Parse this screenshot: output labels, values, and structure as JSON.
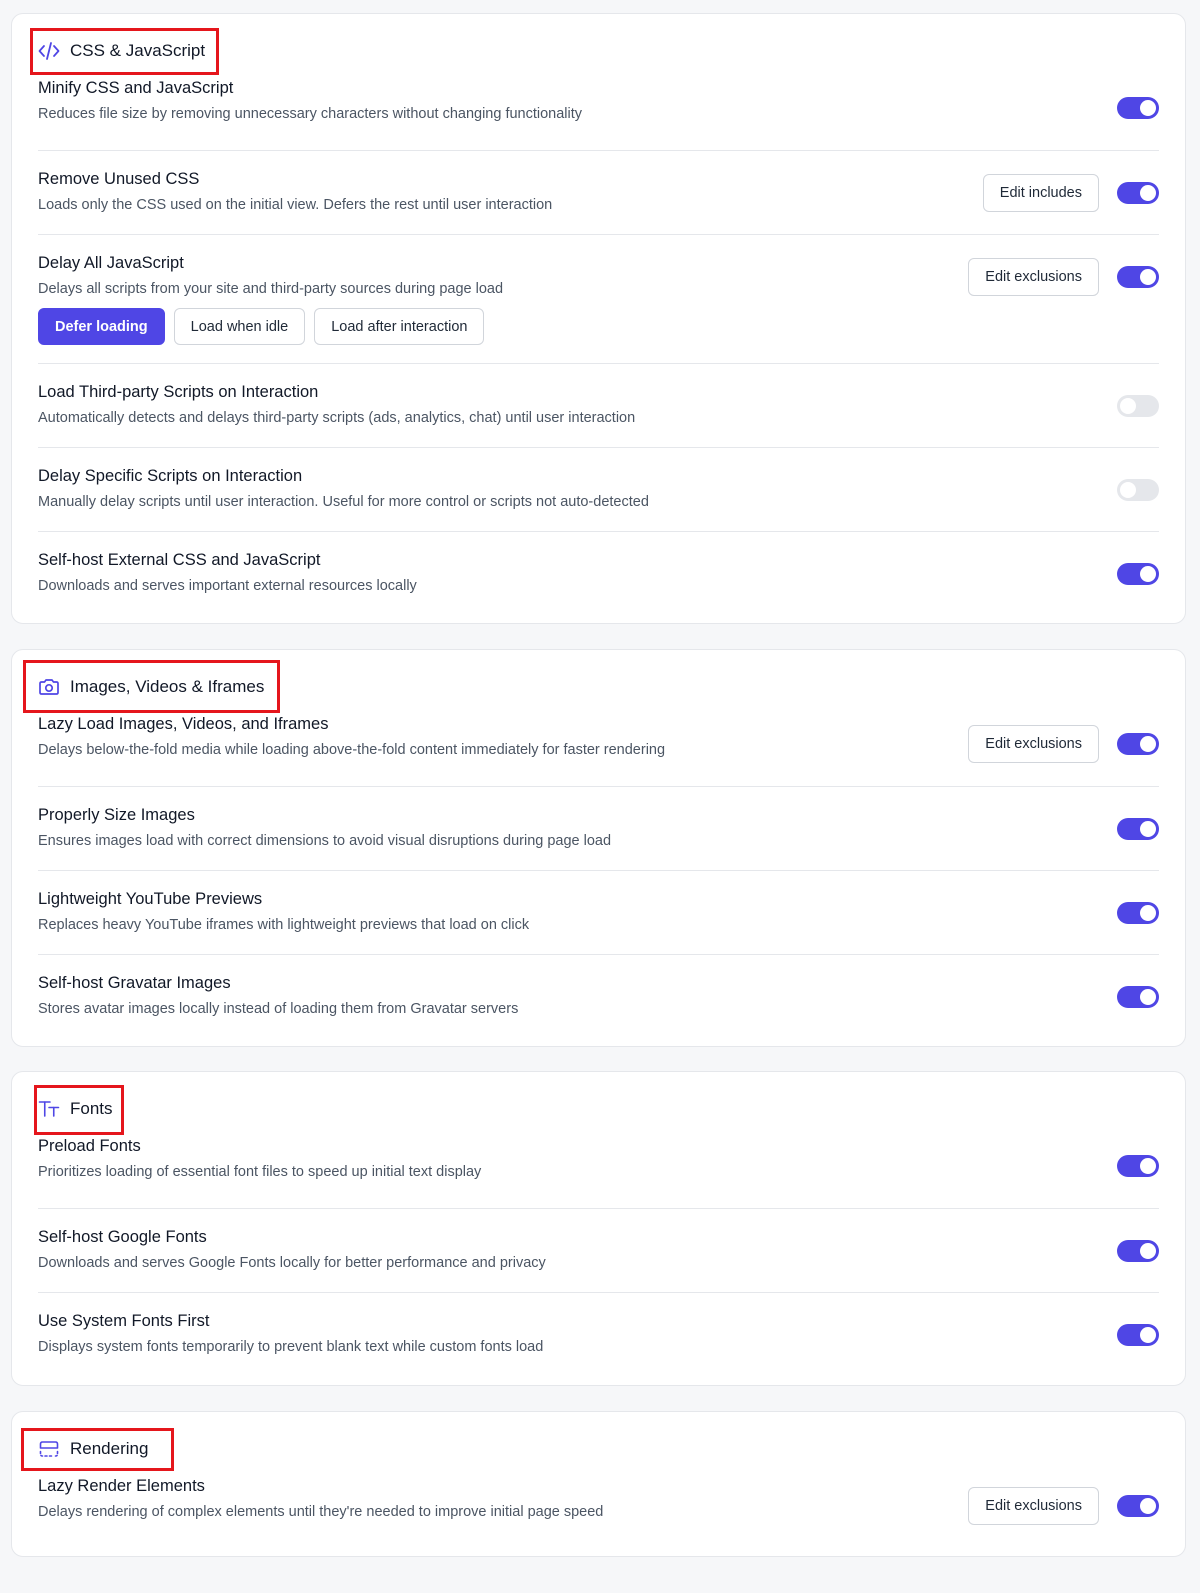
{
  "colors": {
    "accent": "#4f46e5",
    "highlight": "#e5161c",
    "toggle_off": "#e5e7eb",
    "background": "#f6f7f9"
  },
  "sections": [
    {
      "title": "CSS & JavaScript",
      "icon": "code-icon",
      "rows": [
        {
          "label": "Minify CSS and JavaScript",
          "desc": "Reduces file size by removing unnecessary characters without changing functionality",
          "enabled": true
        },
        {
          "label": "Remove Unused CSS",
          "desc": "Loads only the CSS used on the initial view. Defers the rest until user interaction",
          "button": "Edit includes",
          "enabled": true
        },
        {
          "label": "Delay All JavaScript",
          "desc": "Delays all scripts from your site and third-party sources during page load",
          "button": "Edit exclusions",
          "enabled": true,
          "choices": [
            "Defer loading",
            "Load when idle",
            "Load after interaction"
          ],
          "selected_choice": "Defer loading"
        },
        {
          "label": "Load Third-party Scripts on Interaction",
          "desc": "Automatically detects and delays third-party scripts (ads, analytics, chat) until user interaction",
          "enabled": false
        },
        {
          "label": "Delay Specific Scripts on Interaction",
          "desc": "Manually delay scripts until user interaction. Useful for more control or scripts not auto-detected",
          "enabled": false
        },
        {
          "label": "Self-host External CSS and JavaScript",
          "desc": "Downloads and serves important external resources locally",
          "enabled": true
        }
      ]
    },
    {
      "title": "Images, Videos & Iframes",
      "icon": "camera-icon",
      "rows": [
        {
          "label": "Lazy Load Images, Videos, and Iframes",
          "desc": "Delays below-the-fold media while loading above-the-fold content immediately for faster rendering",
          "button": "Edit exclusions",
          "enabled": true
        },
        {
          "label": "Properly Size Images",
          "desc": "Ensures images load with correct dimensions to avoid visual disruptions during page load",
          "enabled": true
        },
        {
          "label": "Lightweight YouTube Previews",
          "desc": "Replaces heavy YouTube iframes with lightweight previews that load on click",
          "enabled": true
        },
        {
          "label": "Self-host Gravatar Images",
          "desc": "Stores avatar images locally instead of loading them from Gravatar servers",
          "enabled": true
        }
      ]
    },
    {
      "title": "Fonts",
      "icon": "text-size-icon",
      "rows": [
        {
          "label": "Preload Fonts",
          "desc": "Prioritizes loading of essential font files to speed up initial text display",
          "enabled": true
        },
        {
          "label": "Self-host Google Fonts",
          "desc": "Downloads and serves Google Fonts locally for better performance and privacy",
          "enabled": true
        },
        {
          "label": "Use System Fonts First",
          "desc": "Displays system fonts temporarily to prevent blank text while custom fonts load",
          "enabled": true
        }
      ]
    },
    {
      "title": "Rendering",
      "icon": "layout-render-icon",
      "rows": [
        {
          "label": "Lazy Render Elements",
          "desc": "Delays rendering of complex elements until they're needed to improve initial page speed",
          "button": "Edit exclusions",
          "enabled": true
        }
      ]
    }
  ]
}
